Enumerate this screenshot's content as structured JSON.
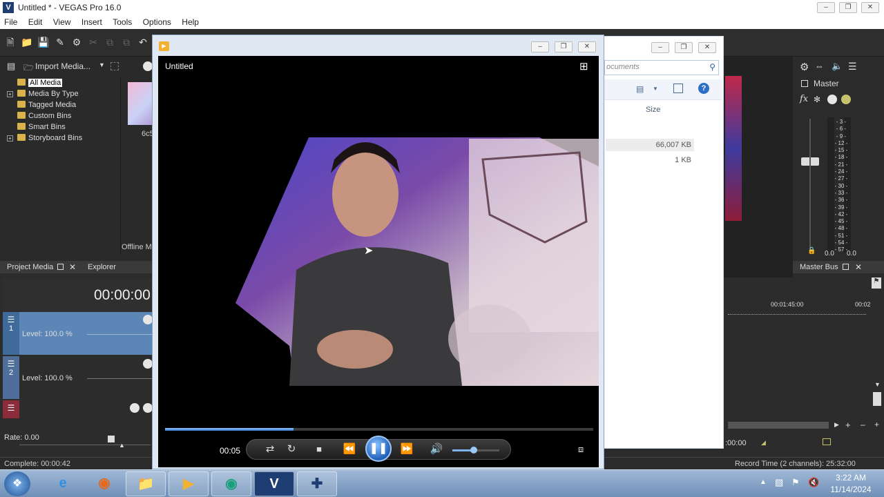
{
  "app": {
    "title": "Untitled * - VEGAS Pro 16.0",
    "logo_letter": "V"
  },
  "menu": [
    "File",
    "Edit",
    "View",
    "Insert",
    "Tools",
    "Options",
    "Help"
  ],
  "media_panel": {
    "import_label": "Import Media...",
    "tree": [
      {
        "label": "All Media",
        "expandable": false,
        "selected": true
      },
      {
        "label": "Media By Type",
        "expandable": true,
        "selected": false
      },
      {
        "label": "Tagged Media",
        "expandable": false,
        "selected": false
      },
      {
        "label": "Custom Bins",
        "expandable": false,
        "selected": false
      },
      {
        "label": "Smart Bins",
        "expandable": false,
        "selected": false
      },
      {
        "label": "Storyboard Bins",
        "expandable": true,
        "selected": false
      }
    ],
    "thumb_label": "6c5",
    "offline_label": "Offline M"
  },
  "tabs": {
    "project_media": "Project Media",
    "explorer": "Explorer"
  },
  "timecode": "00:00:00",
  "tracks": [
    {
      "number": "1",
      "level": "Level: 100.0 %",
      "color": "#5b86b6"
    },
    {
      "number": "2",
      "level": "Level: 100.0 %",
      "color": "#4f6f9a"
    },
    {
      "number": "3",
      "level": "",
      "color": "#8b2c3b"
    }
  ],
  "rate": "Rate: 0.00",
  "status": {
    "complete": "Complete: 00:00:42",
    "record_time": "Record Time (2 channels): 25:32:00"
  },
  "explorer": {
    "search_placeholder": "ocuments",
    "size_header": "Size",
    "sizes": [
      "66,007 KB",
      "1 KB"
    ]
  },
  "master": {
    "label": "Master",
    "bus_label": "Master Bus",
    "scale": [
      "3",
      "6",
      "9",
      "12",
      "15",
      "18",
      "21",
      "24",
      "27",
      "30",
      "33",
      "36",
      "39",
      "42",
      "45",
      "48",
      "51",
      "54",
      "57"
    ],
    "left_value": "0.0",
    "right_value": "0.0"
  },
  "timeline_right": {
    "marker1": "00:01:45:00",
    "marker2": "00:02",
    "time_small": ":00:00"
  },
  "player": {
    "title": "Untitled",
    "elapsed": "00:05",
    "progress": 0.3,
    "volume": 0.45
  },
  "taskbar": {
    "time": "3:22 AM",
    "date": "11/14/2024"
  },
  "colors": {
    "accent": "#3a7bd5",
    "track1": "#5b86b6",
    "track2": "#4f6f9a",
    "track3": "#8b2c3b"
  }
}
